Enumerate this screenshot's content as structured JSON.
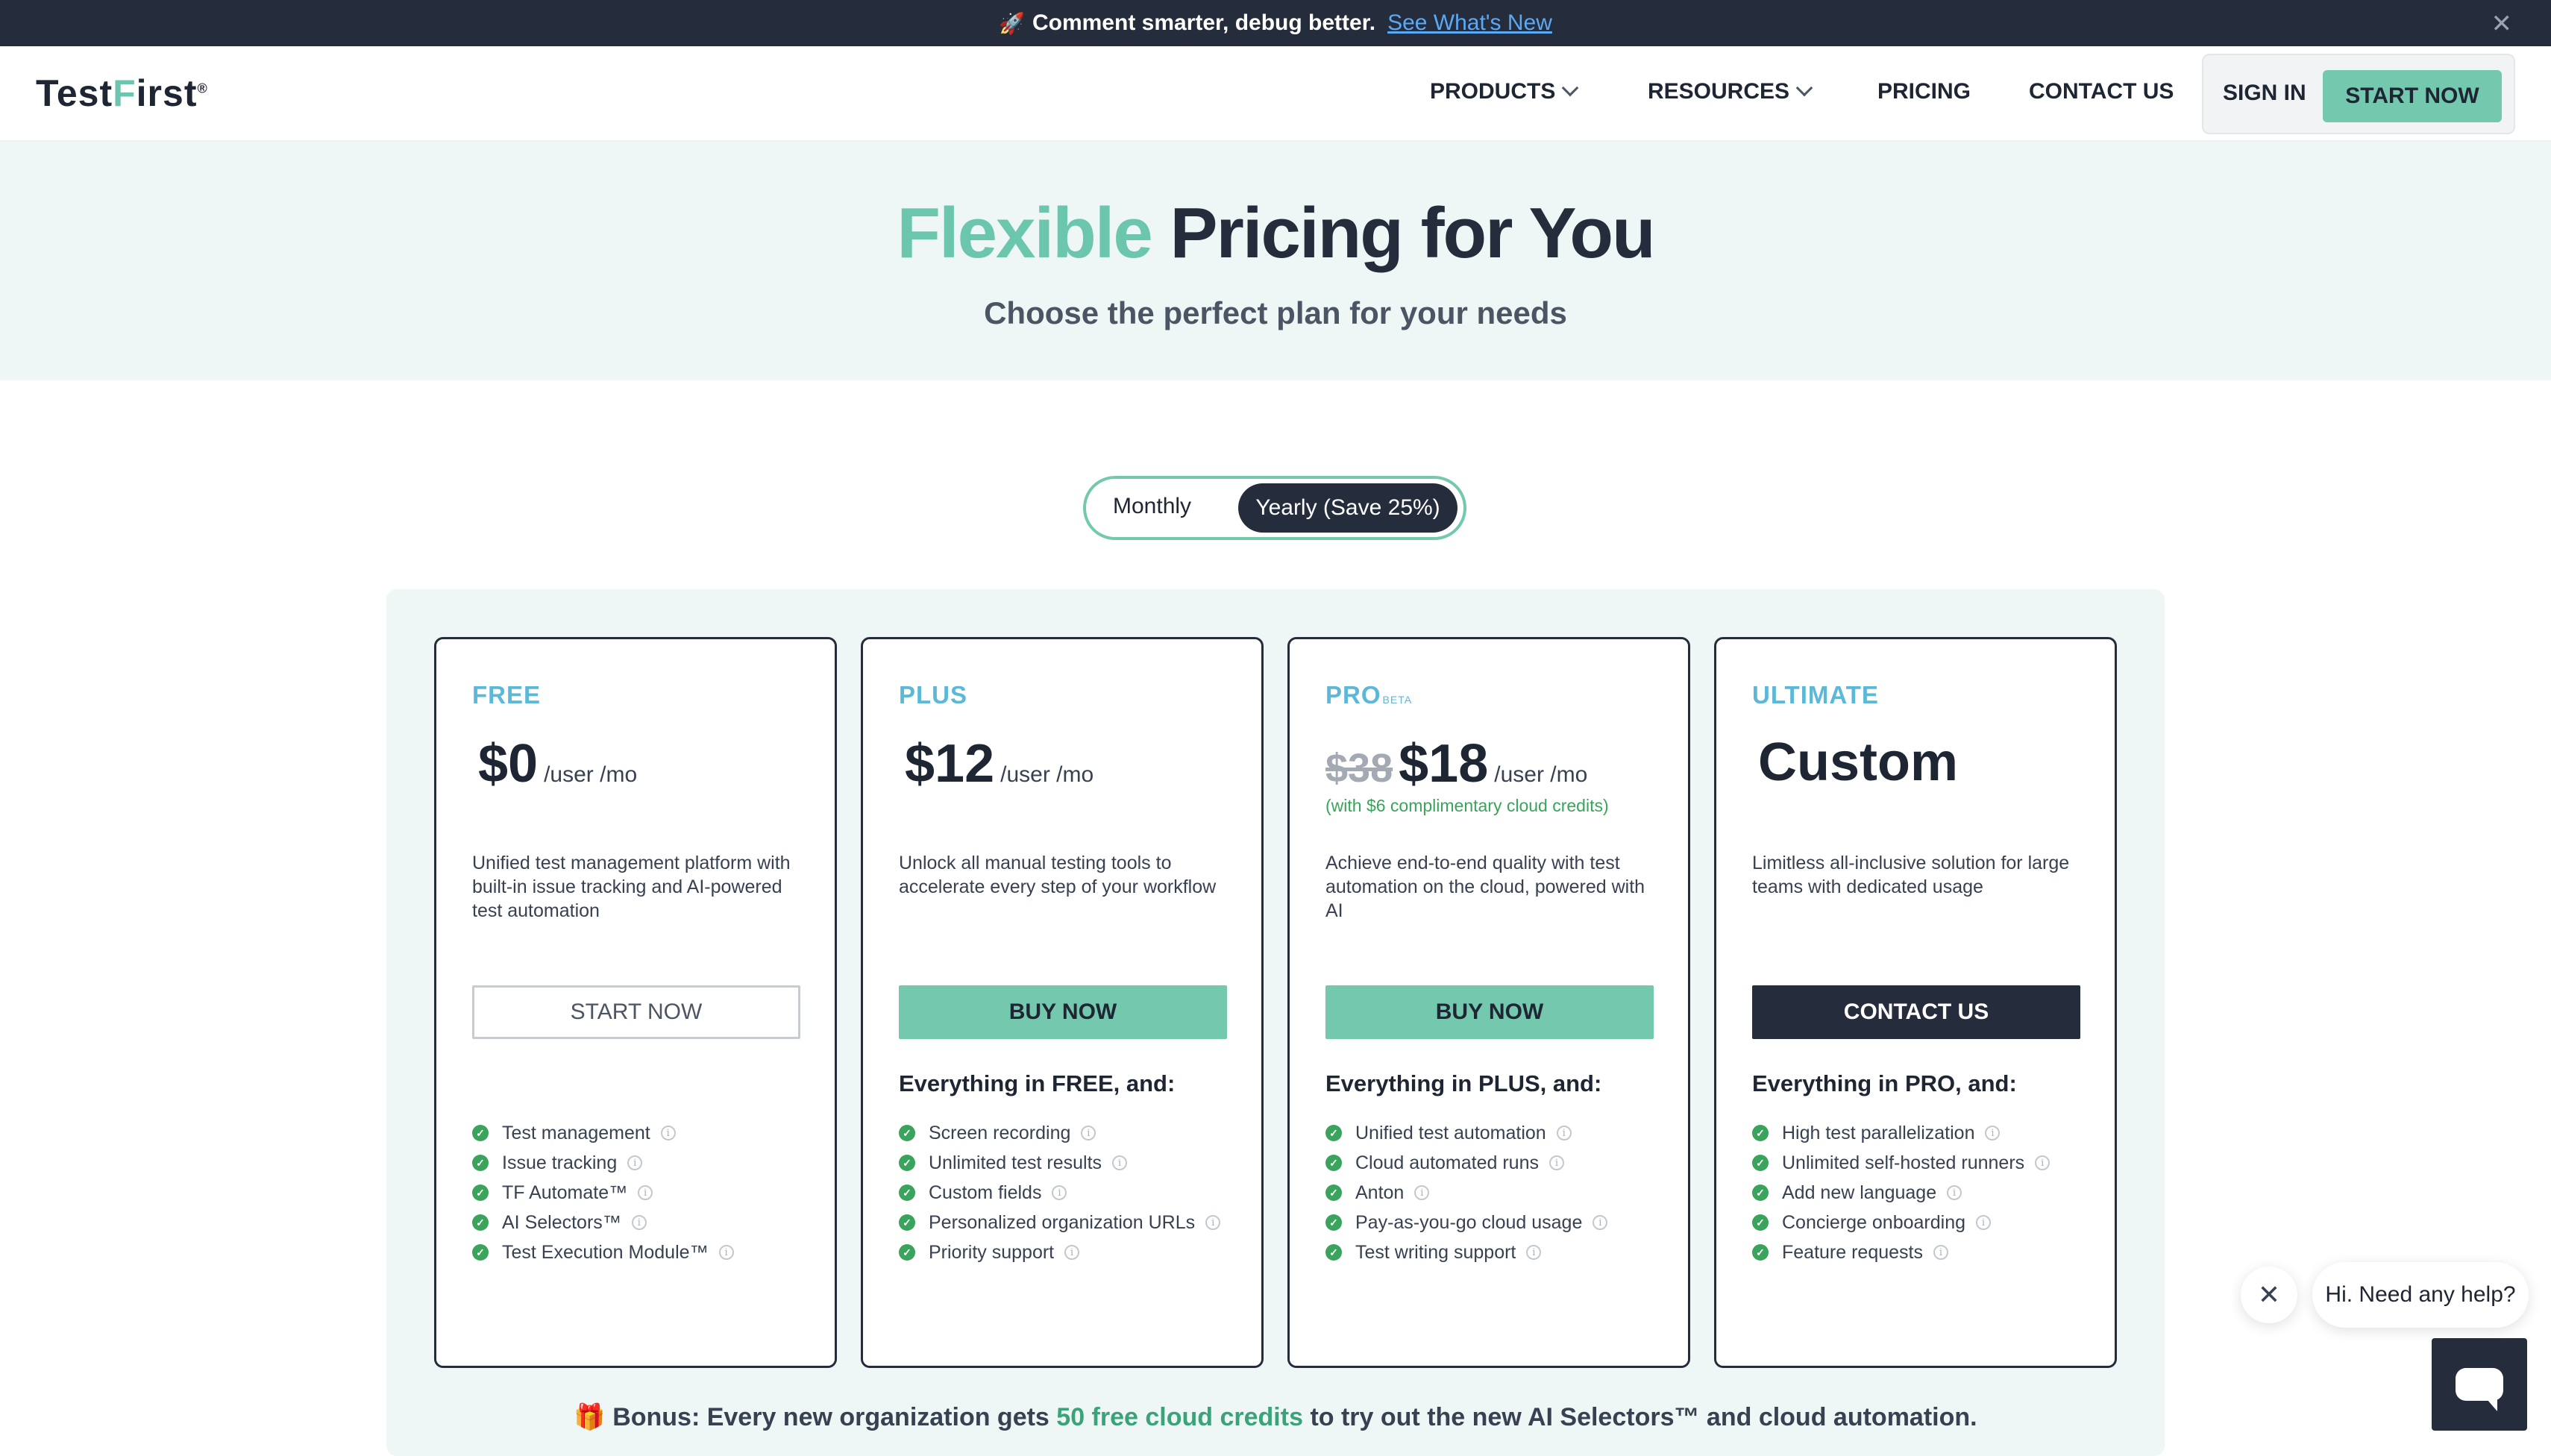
{
  "announcement": {
    "icon": "rocket-icon",
    "text": "Comment smarter, debug better.",
    "link": "See What's New"
  },
  "nav": {
    "logo_prefix": "Test",
    "logo_f": "F",
    "logo_suffix": "irst",
    "logo_reg": "®",
    "products": "PRODUCTS",
    "resources": "RESOURCES",
    "pricing": "PRICING",
    "contact": "CONTACT US",
    "sign_in": "SIGN IN",
    "start_now": "START NOW"
  },
  "hero": {
    "title_accent": "Flexible",
    "title_rest": "Pricing for You",
    "subtitle": "Choose the perfect plan for your needs"
  },
  "billing_toggle": {
    "monthly": "Monthly",
    "yearly": "Yearly (Save 25%)",
    "selected": "yearly"
  },
  "plans": [
    {
      "name": "FREE",
      "price": "$0",
      "per": "/user /mo",
      "description": "Unified test management platform with built-in issue tracking and AI-powered test automation",
      "cta": "START NOW",
      "includes": "",
      "features": [
        "Test management",
        "Issue tracking",
        "TF Automate™",
        "AI Selectors™",
        "Test Execution Module™"
      ]
    },
    {
      "name": "PLUS",
      "price": "$12",
      "per": "/user /mo",
      "description": "Unlock all manual testing tools to accelerate every step of your workflow",
      "cta": "BUY NOW",
      "includes": "Everything in FREE, and:",
      "features": [
        "Screen recording",
        "Unlimited test results",
        "Custom fields",
        "Personalized organization URLs",
        "Priority support"
      ]
    },
    {
      "name": "PRO",
      "badge": "BETA",
      "old_price": "$38",
      "price": "$18",
      "per": "/user /mo",
      "credits": "(with $6 complimentary cloud credits)",
      "description": "Achieve end-to-end quality with test automation on the cloud, powered with AI",
      "cta": "BUY NOW",
      "includes": "Everything in PLUS, and:",
      "features": [
        "Unified test automation",
        "Cloud automated runs",
        "Anton",
        "Pay-as-you-go cloud usage",
        "Test writing support"
      ]
    },
    {
      "name": "ULTIMATE",
      "price": "Custom",
      "description": "Limitless all-inclusive solution for large teams with dedicated usage",
      "cta": "CONTACT US",
      "includes": "Everything in PRO, and:",
      "features": [
        "High test parallelization",
        "Unlimited self-hosted runners",
        "Add new language",
        "Concierge onboarding",
        "Feature requests"
      ]
    }
  ],
  "bonus": {
    "icon": "gift-icon",
    "prefix": "Bonus: Every new organization gets",
    "highlight": "50 free cloud credits",
    "suffix": "to try out the new AI Selectors™ and cloud automation."
  },
  "chat": {
    "greeting": "Hi. Need any help?"
  },
  "colors": {
    "accent": "#73c8ae",
    "dark": "#252c3b",
    "tier": "#5bb8d8",
    "check": "#3aa35c"
  }
}
